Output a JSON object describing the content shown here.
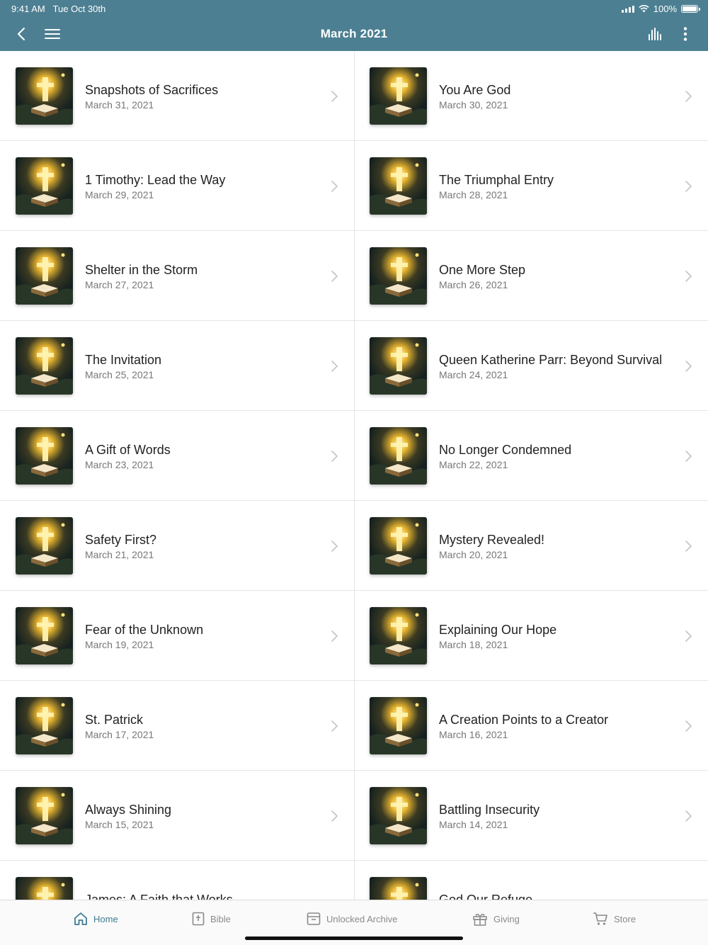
{
  "status_bar": {
    "time": "9:41 AM",
    "date": "Tue Oct 30th",
    "battery": "100%"
  },
  "header": {
    "title": "March 2021"
  },
  "colors": {
    "header_bg": "#4d7f92",
    "accent": "#3f7b93"
  },
  "devotions": [
    {
      "title": "Snapshots of Sacrifices",
      "date": "March 31, 2021"
    },
    {
      "title": "You Are God",
      "date": "March 30, 2021"
    },
    {
      "title": "1 Timothy: Lead the Way",
      "date": "March 29, 2021"
    },
    {
      "title": "The Triumphal Entry",
      "date": "March 28, 2021"
    },
    {
      "title": "Shelter in the Storm",
      "date": "March 27, 2021"
    },
    {
      "title": "One More Step",
      "date": "March 26, 2021"
    },
    {
      "title": "The Invitation",
      "date": "March 25, 2021"
    },
    {
      "title": "Queen Katherine Parr: Beyond Survival",
      "date": "March 24, 2021"
    },
    {
      "title": "A Gift of Words",
      "date": "March 23, 2021"
    },
    {
      "title": "No Longer Condemned",
      "date": "March 22, 2021"
    },
    {
      "title": "Safety First?",
      "date": "March 21, 2021"
    },
    {
      "title": "Mystery Revealed!",
      "date": "March 20, 2021"
    },
    {
      "title": "Fear of the Unknown",
      "date": "March 19, 2021"
    },
    {
      "title": "Explaining Our Hope",
      "date": "March 18, 2021"
    },
    {
      "title": "St. Patrick",
      "date": "March 17, 2021"
    },
    {
      "title": "A Creation Points to a Creator",
      "date": "March 16, 2021"
    },
    {
      "title": "Always Shining",
      "date": "March 15, 2021"
    },
    {
      "title": "Battling Insecurity",
      "date": "March 14, 2021"
    },
    {
      "title": "James: A Faith that Works",
      "date": ""
    },
    {
      "title": "God Our Refuge",
      "date": ""
    }
  ],
  "tabs": [
    {
      "label": "Home",
      "icon": "home-icon",
      "active": true
    },
    {
      "label": "Bible",
      "icon": "bible-icon",
      "active": false
    },
    {
      "label": "Unlocked Archive",
      "icon": "archive-icon",
      "active": false
    },
    {
      "label": "Giving",
      "icon": "gift-icon",
      "active": false
    },
    {
      "label": "Store",
      "icon": "cart-icon",
      "active": false
    }
  ]
}
